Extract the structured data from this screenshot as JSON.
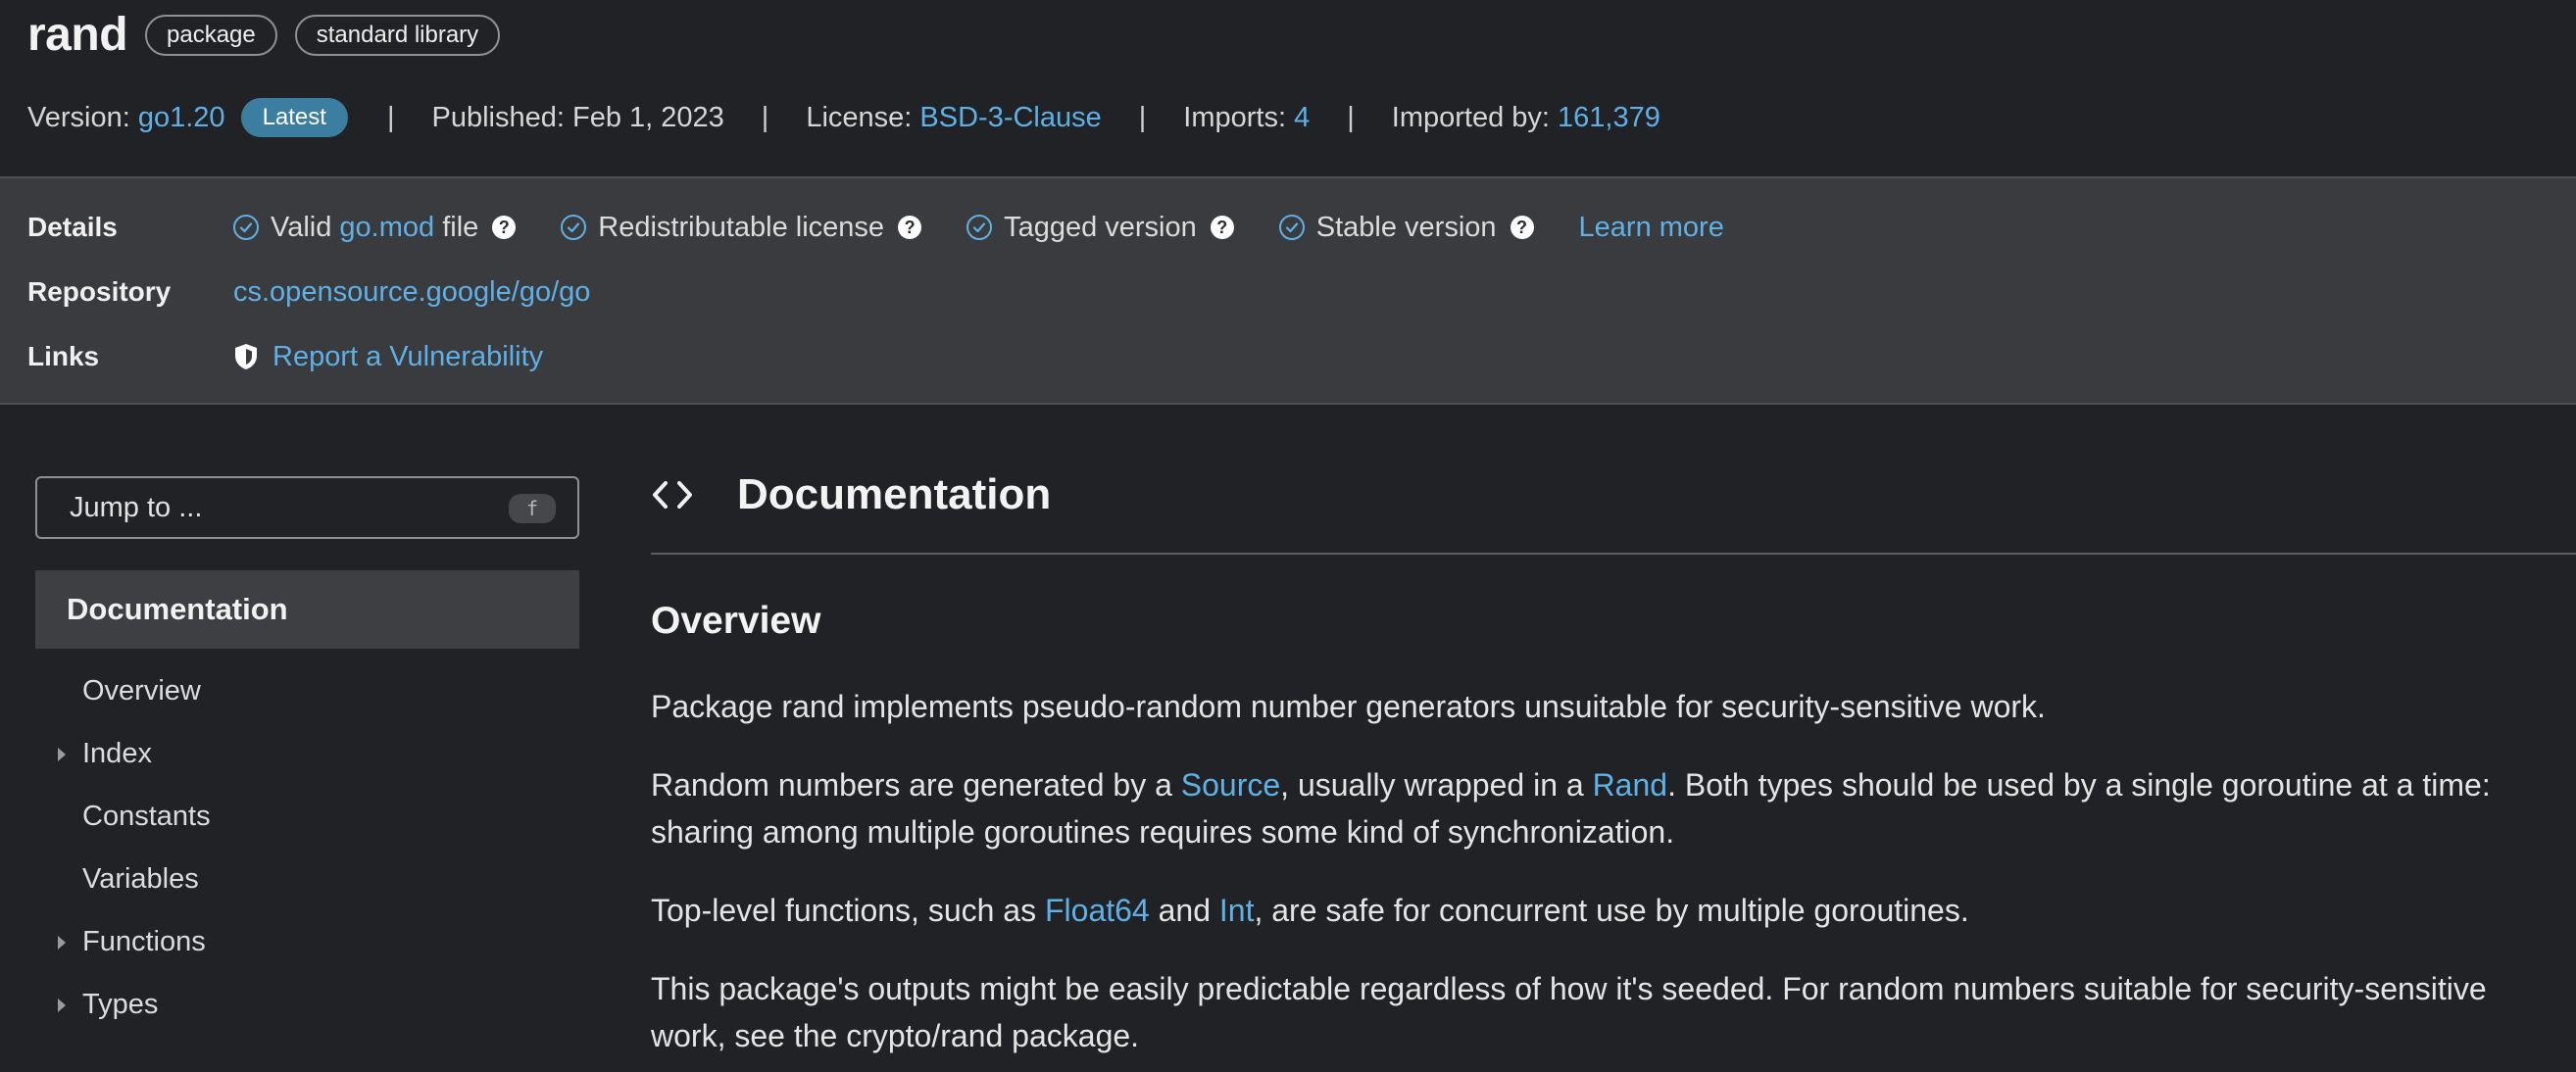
{
  "header": {
    "title": "rand",
    "chips": [
      "package",
      "standard library"
    ],
    "version_label": "Version:",
    "version_value": "go1.20",
    "latest_badge": "Latest",
    "separator": "|",
    "published": "Published: Feb 1, 2023",
    "license_label": "License:",
    "license_value": "BSD-3-Clause",
    "imports_label": "Imports:",
    "imports_value": "4",
    "imported_by_label": "Imported by:",
    "imported_by_value": "161,379"
  },
  "details": {
    "details_label": "Details",
    "valid_pre": "Valid",
    "valid_link": "go.mod",
    "valid_post": "file",
    "redistributable": "Redistributable license",
    "tagged": "Tagged version",
    "stable": "Stable version",
    "help_glyph": "?",
    "learn_more": "Learn more",
    "repository_label": "Repository",
    "repository_value": "cs.opensource.google/go/go",
    "links_label": "Links",
    "report_link": "Report a Vulnerability"
  },
  "sidebar": {
    "jump_placeholder": "Jump to ...",
    "jump_shortcut": "f",
    "active": "Documentation",
    "items": [
      {
        "label": "Overview",
        "expandable": false
      },
      {
        "label": "Index",
        "expandable": true
      },
      {
        "label": "Constants",
        "expandable": false
      },
      {
        "label": "Variables",
        "expandable": false
      },
      {
        "label": "Functions",
        "expandable": true
      },
      {
        "label": "Types",
        "expandable": true
      }
    ]
  },
  "main": {
    "section_title": "Documentation",
    "overview_heading": "Overview",
    "p1": "Package rand implements pseudo-random number generators unsuitable for security-sensitive work.",
    "p2_a": "Random numbers are generated by a ",
    "p2_link1": "Source",
    "p2_b": ", usually wrapped in a ",
    "p2_link2": "Rand",
    "p2_c": ". Both types should be used by a single goroutine at a time: sharing among multiple goroutines requires some kind of synchronization.",
    "p3_a": "Top-level functions, such as ",
    "p3_link1": "Float64",
    "p3_b": " and ",
    "p3_link2": "Int",
    "p3_c": ", are safe for concurrent use by multiple goroutines.",
    "p4": "This package's outputs might be easily predictable regardless of how it's seeded. For random numbers suitable for security-sensitive work, see the crypto/rand package."
  },
  "colors": {
    "background": "#212225",
    "details_band": "#3a3b3e",
    "link": "#5fb0e6",
    "badge": "#3b7ea1"
  }
}
